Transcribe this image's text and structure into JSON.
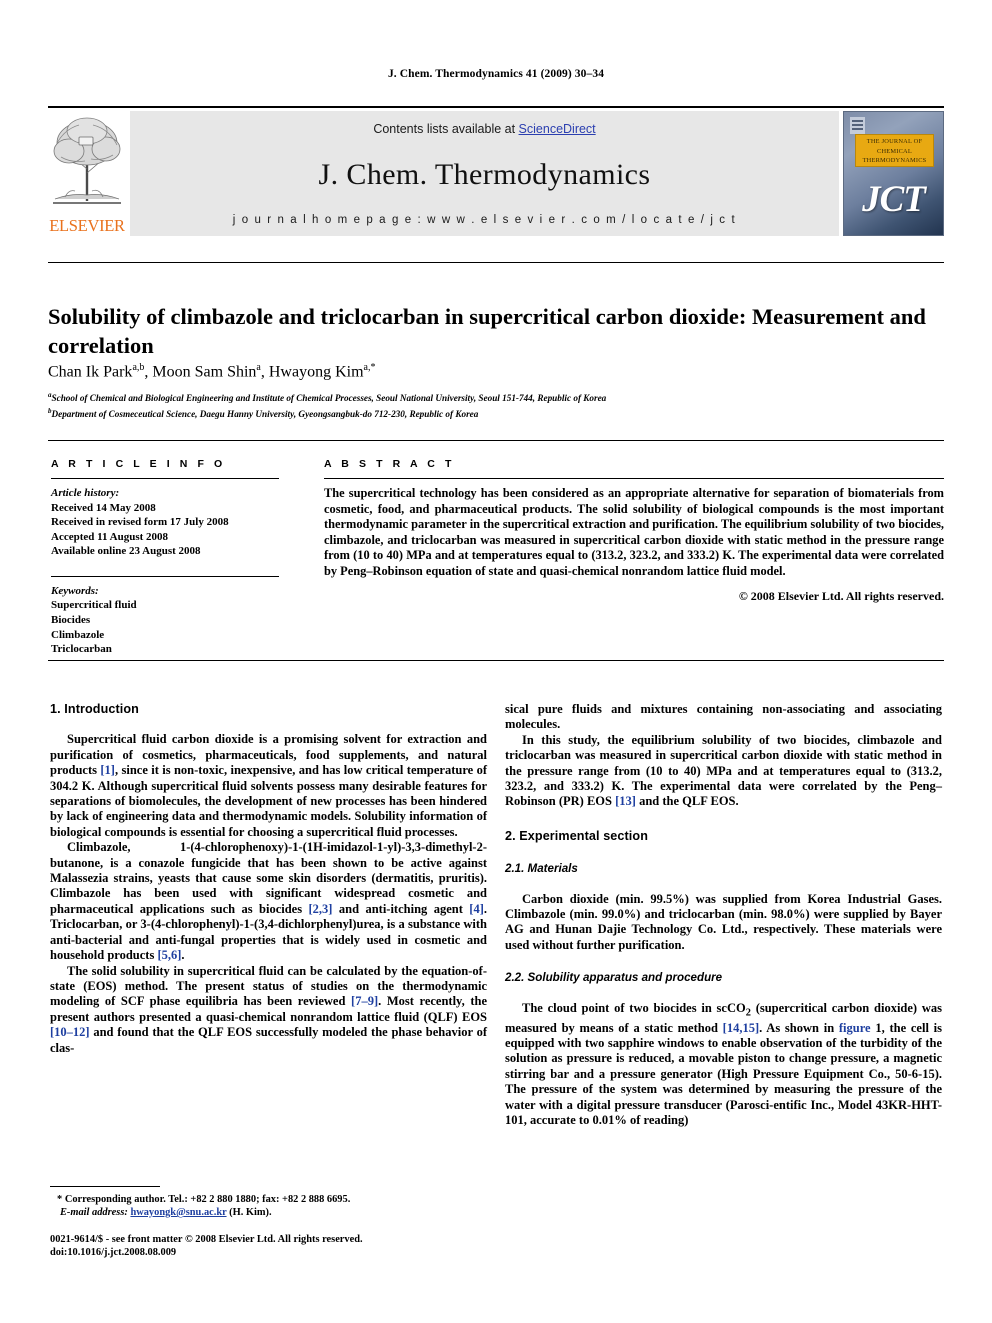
{
  "running_head": "J. Chem. Thermodynamics 41 (2009) 30–34",
  "masthead": {
    "publisher_name": "ELSEVIER",
    "contents_prefix": "Contents lists available at ",
    "contents_link": "ScienceDirect",
    "journal_title": "J. Chem. Thermodynamics",
    "homepage": "j o u r n a l   h o m e p a g e :   w w w . e l s e v i e r . c o m / l o c a t e / j c t",
    "cover": {
      "title_lines": "THE JOURNAL OF CHEMICAL THERMODYNAMICS",
      "acronym": "JCT"
    }
  },
  "article": {
    "title": "Solubility of climbazole and triclocarban in supercritical carbon dioxide: Measurement and correlation",
    "authors_html": "Chan Ik Park<sup>a,b</sup>, Moon Sam Shin<sup>a</sup>, Hwayong Kim<sup>a,*</sup>",
    "affiliation_a": "School of Chemical and Biological Engineering and Institute of Chemical Processes, Seoul National University, Seoul 151-744, Republic of Korea",
    "affiliation_b": "Department of Cosmeceutical Science, Daegu Hanny University, Gyeongsangbuk-do 712-230, Republic of Korea"
  },
  "info": {
    "heading": "A R T I C L E   I N F O",
    "history_label": "Article history:",
    "history": [
      "Received 14 May 2008",
      "Received in revised form 17 July 2008",
      "Accepted 11 August 2008",
      "Available online 23 August 2008"
    ],
    "keywords_label": "Keywords:",
    "keywords": [
      "Supercritical fluid",
      "Biocides",
      "Climbazole",
      "Triclocarban"
    ]
  },
  "abstract": {
    "heading": "A B S T R A C T",
    "body": "The supercritical technology has been considered as an appropriate alternative for separation of biomaterials from cosmetic, food, and pharmaceutical products. The solid solubility of biological compounds is the most important thermodynamic parameter in the supercritical extraction and purification. The equilibrium solubility of two biocides, climbazole, and triclocarban was measured in supercritical carbon dioxide with static method in the pressure range from (10 to 40) MPa and at temperatures equal to (313.2, 323.2, and 333.2) K. The experimental data were correlated by Peng–Robinson equation of state and quasi-chemical nonrandom lattice fluid model.",
    "copyright": "© 2008 Elsevier Ltd. All rights reserved."
  },
  "body": {
    "intro_heading": "1. Introduction",
    "intro_p1_a": "Supercritical fluid carbon dioxide is a promising solvent for extraction and purification of cosmetics, pharmaceuticals, food supplements, and natural products ",
    "intro_p1_ref1": "[1]",
    "intro_p1_b": ", since it is non-toxic, inexpensive, and has low critical temperature of 304.2 K. Although supercritical fluid solvents possess many desirable features for separations of biomolecules, the development of new processes has been hindered by lack of engineering data and thermodynamic models. Solubility information of biological compounds is essential for choosing a supercritical fluid processes.",
    "intro_p2_a": "Climbazole, 1-(4-chlorophenoxy)-1-(1H-imidazol-1-yl)-3,3-dimethyl-2-butanone, is a conazole fungicide that has been shown to be active against Malassezia strains, yeasts that cause some skin disorders (dermatitis, pruritis). Climbazole has been used with significant widespread cosmetic and pharmaceutical applications such as biocides ",
    "intro_p2_ref1": "[2,3]",
    "intro_p2_b": " and anti-itching agent ",
    "intro_p2_ref2": "[4]",
    "intro_p2_c": ". Triclocarban, or 3-(4-chlorophenyl)-1-(3,4-dichlorphenyl)urea, is a substance with anti-bacterial and anti-fungal properties that is widely used in cosmetic and household products ",
    "intro_p2_ref3": "[5,6]",
    "intro_p2_d": ".",
    "intro_p3_a": "The solid solubility in supercritical fluid can be calculated by the equation-of-state (EOS) method. The present status of studies on the thermodynamic modeling of SCF phase equilibria has been reviewed ",
    "intro_p3_ref1": "[7–9]",
    "intro_p3_b": ". Most recently, the present authors presented a quasi-chemical nonrandom lattice fluid (QLF) EOS ",
    "intro_p3_ref2": "[10–12]",
    "intro_p3_c": " and found that the QLF EOS successfully modeled the phase behavior of clas-",
    "intro_p4_cont": "sical pure fluids and mixtures containing non-associating and associating molecules.",
    "intro_p5_a": "In this study, the equilibrium solubility of two biocides, climbazole and triclocarban was measured in supercritical carbon dioxide with static method in the pressure range from (10 to 40) MPa and at temperatures equal to (313.2, 323.2, and 333.2) K. The experimental data were correlated by the Peng–Robinson (PR) EOS ",
    "intro_p5_ref1": "[13]",
    "intro_p5_b": " and the QLF EOS.",
    "exp_heading": "2. Experimental section",
    "materials_heading": "2.1. Materials",
    "materials_p": "Carbon dioxide (min. 99.5%) was supplied from Korea Industrial Gases. Climbazole (min. 99.0%) and triclocarban (min. 98.0%) were supplied by Bayer AG and Hunan Dajie Technology Co. Ltd., respectively. These materials were used without further purification.",
    "apparatus_heading": "2.2. Solubility apparatus and procedure",
    "apparatus_p_a": "The cloud point of two biocides in scCO",
    "apparatus_sub": "2",
    "apparatus_p_b": " (supercritical carbon dioxide) was measured by means of a static method ",
    "apparatus_ref1": "[14,15]",
    "apparatus_p_c": ". As shown in ",
    "apparatus_figref": "figure",
    "apparatus_p_d": " 1, the cell is equipped with two sapphire windows to enable observation of the turbidity of the solution as pressure is reduced, a movable piston to change pressure, a magnetic stirring bar and a pressure generator (High Pressure Equipment Co., 50-6-15). The pressure of the system was determined by measuring the pressure of the water with a digital pressure transducer (Parosci-entific Inc., Model 43KR-HHT-101, accurate to 0.01% of reading)"
  },
  "footnote": {
    "marker": "*",
    "corresponding": "Corresponding author. Tel.: +82 2 880 1880; fax: +82 2 888 6695.",
    "email_label": "E-mail address:",
    "email": "hwayongk@snu.ac.kr",
    "email_suffix": "(H. Kim)."
  },
  "issn_footer": {
    "line1": "0021-9614/$ - see front matter © 2008 Elsevier Ltd. All rights reserved.",
    "line2": "doi:10.1016/j.jct.2008.08.009"
  },
  "colors": {
    "link_blue": "#1e3fa0",
    "sciencedirect_blue": "#2b3fb0",
    "elsevier_orange": "#E9711C",
    "masthead_grey": "#e7e7e7",
    "cover_gold": "#e8a912"
  }
}
